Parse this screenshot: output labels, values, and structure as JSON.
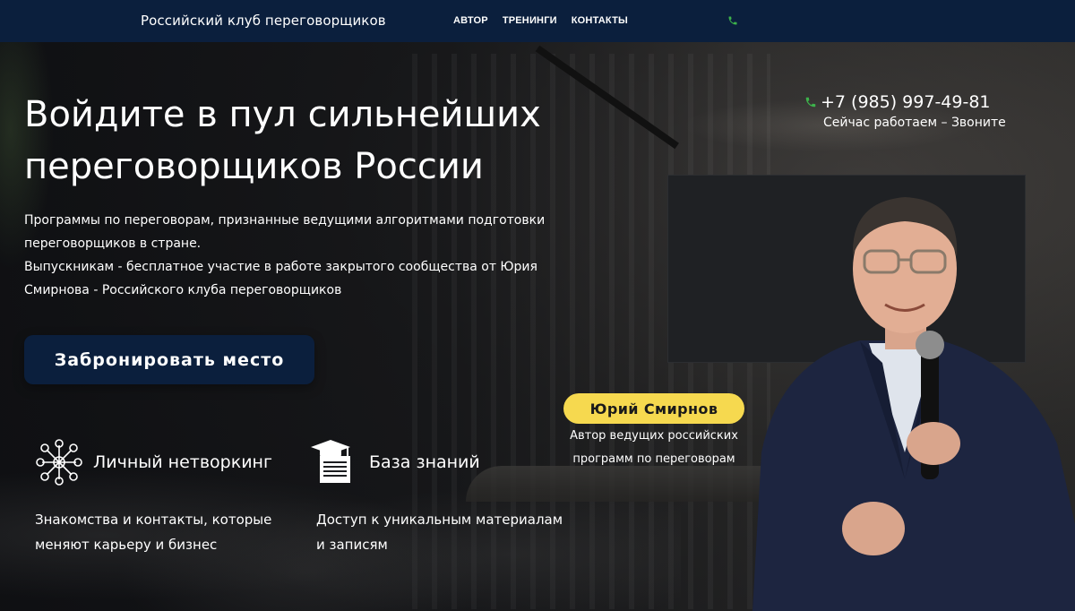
{
  "header": {
    "brand": "Российский клуб переговорщиков",
    "nav": [
      {
        "label": "АВТОР"
      },
      {
        "label": "ТРЕНИНГИ"
      },
      {
        "label": "КОНТАКТЫ"
      }
    ],
    "phone_icon": "phone-icon"
  },
  "hero": {
    "title_line1": "Войдите в пул сильнейших",
    "title_line2": "переговорщиков России",
    "desc_line1": "Программы по переговорам, признанные ведущими алгоритмами подготовки",
    "desc_line2": "переговорщиков в стране.",
    "desc_line3": "Выпускникам - бесплатное участие в работе закрытого сообщества от Юрия",
    "desc_line4": "Смирнова - Российского клуба переговорщиков",
    "cta_label": "Забронировать место"
  },
  "features": [
    {
      "icon": "network-icon",
      "title": "Личный нетворкинг",
      "desc_line1": "Знакомства и контакты, которые",
      "desc_line2": "меняют карьеру и бизнес"
    },
    {
      "icon": "knowledge-base-icon",
      "title": "База знаний",
      "desc_line1": "Доступ к уникальным материалам",
      "desc_line2": "и записям"
    }
  ],
  "contact": {
    "phone": "+7 (985) 997-49-81",
    "status": "Сейчас работаем – Звоните"
  },
  "speaker": {
    "name": "Юрий Смирнов",
    "caption_line1": "Автор ведущих российских",
    "caption_line2": "программ по переговорам"
  },
  "colors": {
    "header_bg": "#0b1f3d",
    "cta_bg": "#0b1f3d",
    "badge_bg": "#f6d94f",
    "phone_icon": "#3db24b"
  }
}
